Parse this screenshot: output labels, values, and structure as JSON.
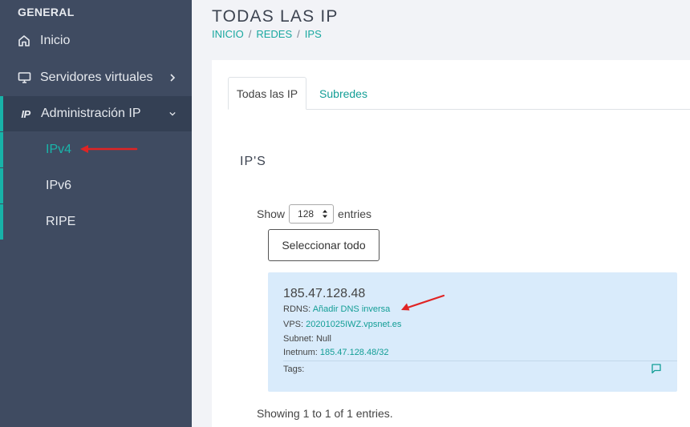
{
  "sidebar": {
    "heading": "GENERAL",
    "items": [
      {
        "label": "Inicio",
        "icon": "home-icon"
      },
      {
        "label": "Servidores virtuales",
        "icon": "monitor-icon"
      },
      {
        "label": "Administración IP",
        "icon": "ip-icon",
        "icon_text": "IP"
      }
    ],
    "subitems": [
      {
        "label": "IPv4"
      },
      {
        "label": "IPv6"
      },
      {
        "label": "RIPE"
      }
    ]
  },
  "header": {
    "title": "TODAS LAS IP",
    "breadcrumb": [
      "INICIO",
      "REDES",
      "IPS"
    ],
    "breadcrumb_separator": "/"
  },
  "tabs": [
    {
      "label": "Todas las IP",
      "active": true
    },
    {
      "label": "Subredes",
      "active": false
    }
  ],
  "section": {
    "title": "IP'S"
  },
  "entries": {
    "show_label": "Show",
    "selected": "128",
    "entries_label": "entries",
    "select_all_label": "Seleccionar todo",
    "footer": "Showing 1 to 1 of 1 entries."
  },
  "ip_card": {
    "ip": "185.47.128.48",
    "rdns_label": "RDNS:",
    "rdns_value": "Añadir DNS inversa",
    "vps_label": "VPS:",
    "vps_value": "20201025IWZ.vpsnet.es",
    "subnet_label": "Subnet:",
    "subnet_value": "Null",
    "inetnum_label": "Inetnum:",
    "inetnum_value": "185.47.128.48/32",
    "tags_label": "Tags:"
  },
  "colors": {
    "sidebar_bg": "#3f4b61",
    "accent": "#19b5aa",
    "card_bg": "#d9ebfb",
    "annotation_arrow": "#e02424"
  }
}
